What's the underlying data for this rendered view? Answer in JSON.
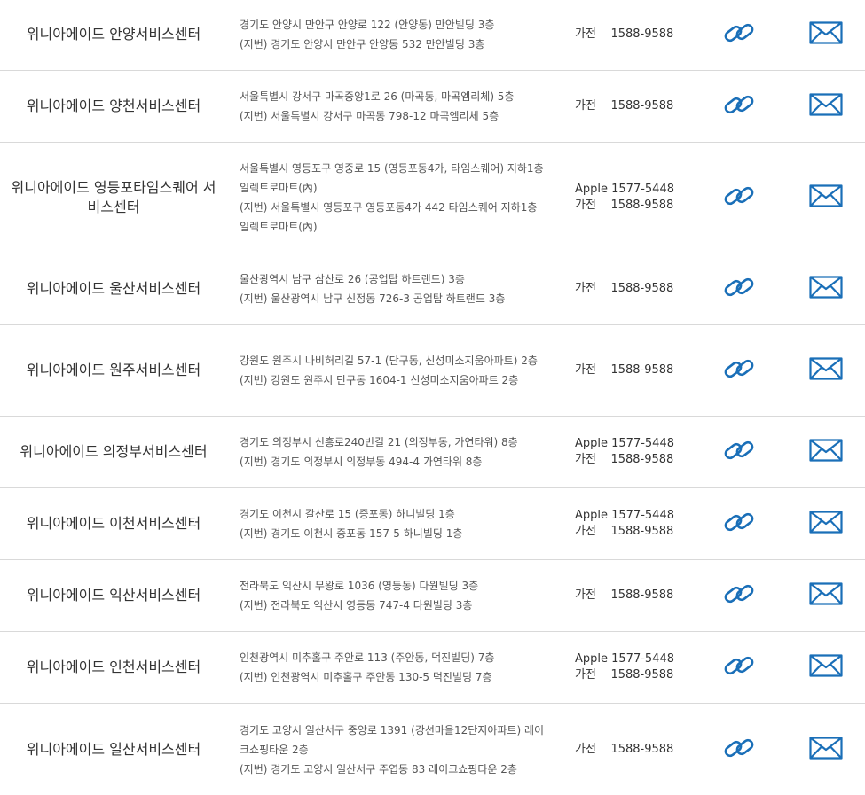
{
  "icons": {
    "link": "link-icon",
    "mail": "envelope-icon",
    "icon_color": "#1a6fb8"
  },
  "rows": [
    {
      "name": "위니아에이드 안양서비스센터",
      "address": [
        "경기도 안양시 만안구 안양로 122 (안양동) 만안빌딩 3층",
        "(지번) 경기도 안양시 만안구 안양동 532 만안빌딩 3층"
      ],
      "phones": [
        "가전    1588-9588"
      ]
    },
    {
      "name": "위니아에이드 양천서비스센터",
      "address": [
        "서울특별시 강서구 마곡중앙1로 26 (마곡동, 마곡엠리체) 5층",
        "(지번) 서울특별시 강서구 마곡동 798-12 마곡엠리체 5층"
      ],
      "phones": [
        "가전    1588-9588"
      ]
    },
    {
      "name": "위니아에이드 영등포타임스퀘어 서비스센터",
      "address": [
        "서울특별시 영등포구 영중로 15 (영등포동4가, 타임스퀘어) 지하1층 일렉트로마트(內)",
        "(지번) 서울특별시 영등포구 영등포동4가 442 타임스퀘어 지하1층 일렉트로마트(內)"
      ],
      "phones": [
        "Apple 1577-5448",
        "가전    1588-9588"
      ]
    },
    {
      "name": "위니아에이드 울산서비스센터",
      "address": [
        "울산광역시 남구 삼산로 26 (공업탑 하트랜드) 3층",
        "(지번) 울산광역시 남구 신정동 726-3 공업탑 하트랜드 3층"
      ],
      "phones": [
        "가전    1588-9588"
      ]
    },
    {
      "name": "위니아에이드 원주서비스센터",
      "address": [
        "강원도 원주시 나비허리길 57-1 (단구동, 신성미소지움아파트) 2층",
        "(지번) 강원도 원주시 단구동 1604-1 신성미소지움아파트 2층"
      ],
      "phones": [
        "가전    1588-9588"
      ]
    },
    {
      "name": "위니아에이드 의정부서비스센터",
      "address": [
        "경기도 의정부시 신흥로240번길 21 (의정부동, 가연타워) 8층",
        "(지번) 경기도 의정부시 의정부동 494-4 가연타워 8층"
      ],
      "phones": [
        "Apple 1577-5448",
        "가전    1588-9588"
      ]
    },
    {
      "name": "위니아에이드 이천서비스센터",
      "address": [
        "경기도 이천시 갈산로 15 (증포동) 하니빌딩 1층",
        "(지번) 경기도 이천시 증포동 157-5 하니빌딩 1층"
      ],
      "phones": [
        "Apple 1577-5448",
        "가전    1588-9588"
      ]
    },
    {
      "name": "위니아에이드 익산서비스센터",
      "address": [
        "전라북도 익산시 무왕로 1036 (영등동) 다원빌딩 3층",
        "(지번) 전라북도 익산시 영등동 747-4 다원빌딩 3층"
      ],
      "phones": [
        "가전    1588-9588"
      ]
    },
    {
      "name": "위니아에이드 인천서비스센터",
      "address": [
        "인천광역시 미추홀구 주안로 113 (주안동, 덕진빌딩) 7층",
        "(지번) 인천광역시 미추홀구 주안동 130-5 덕진빌딩 7층"
      ],
      "phones": [
        "Apple 1577-5448",
        "가전    1588-9588"
      ]
    },
    {
      "name": "위니아에이드 일산서비스센터",
      "address": [
        "경기도 고양시 일산서구 중앙로 1391 (강선마을12단지아파트) 레이크쇼핑타운 2층",
        "(지번) 경기도 고양시 일산서구 주엽동 83 레이크쇼핑타운 2층"
      ],
      "phones": [
        "가전    1588-9588"
      ]
    }
  ]
}
